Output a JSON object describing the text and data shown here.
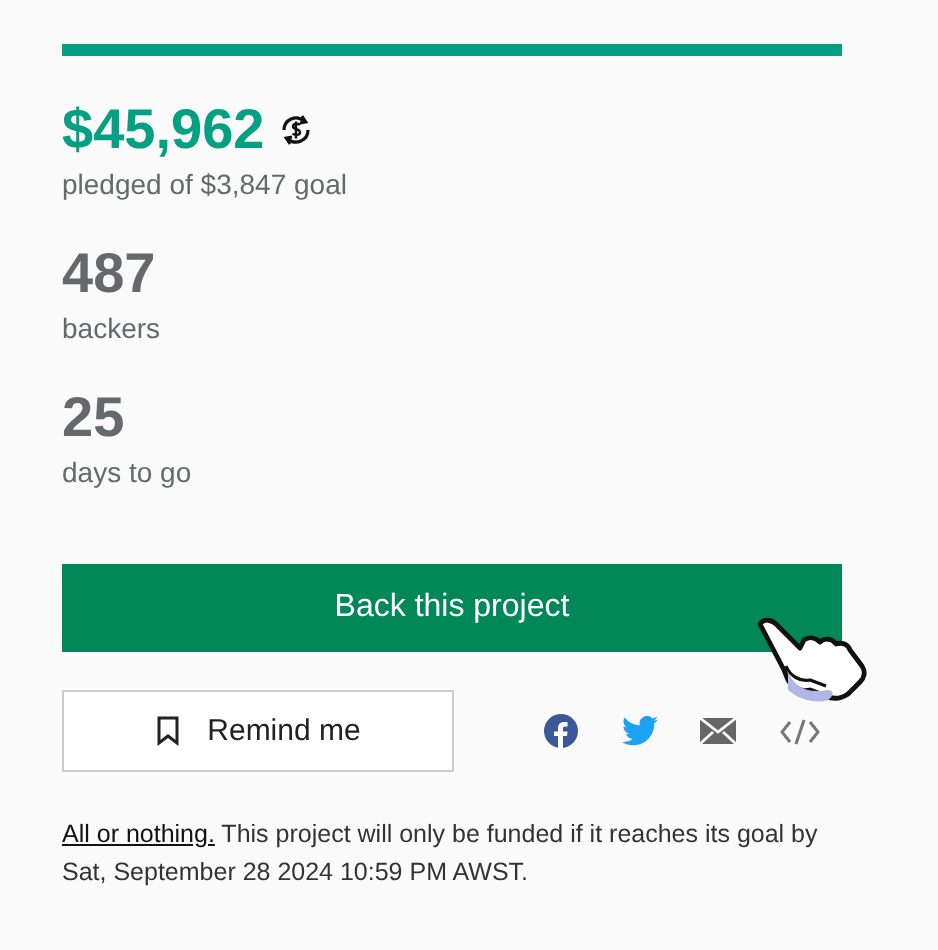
{
  "funding_progress": {
    "level": 1
  },
  "pledged": {
    "amount": "$45,962",
    "caption": "pledged of $3,847 goal"
  },
  "stats": [
    {
      "value": "487",
      "label": "backers"
    },
    {
      "value": "25",
      "label": "days to go"
    }
  ],
  "back_button": "Back this project",
  "remind_button": "Remind me",
  "share_icons": [
    {
      "kind": "facebook"
    },
    {
      "kind": "twitter"
    },
    {
      "kind": "email"
    },
    {
      "kind": "embed"
    }
  ],
  "notice": {
    "link": "All or nothing.",
    "text": "This project will only be funded if it reaches its goal by Sat, September 28 2024 10:59 PM AWST."
  }
}
